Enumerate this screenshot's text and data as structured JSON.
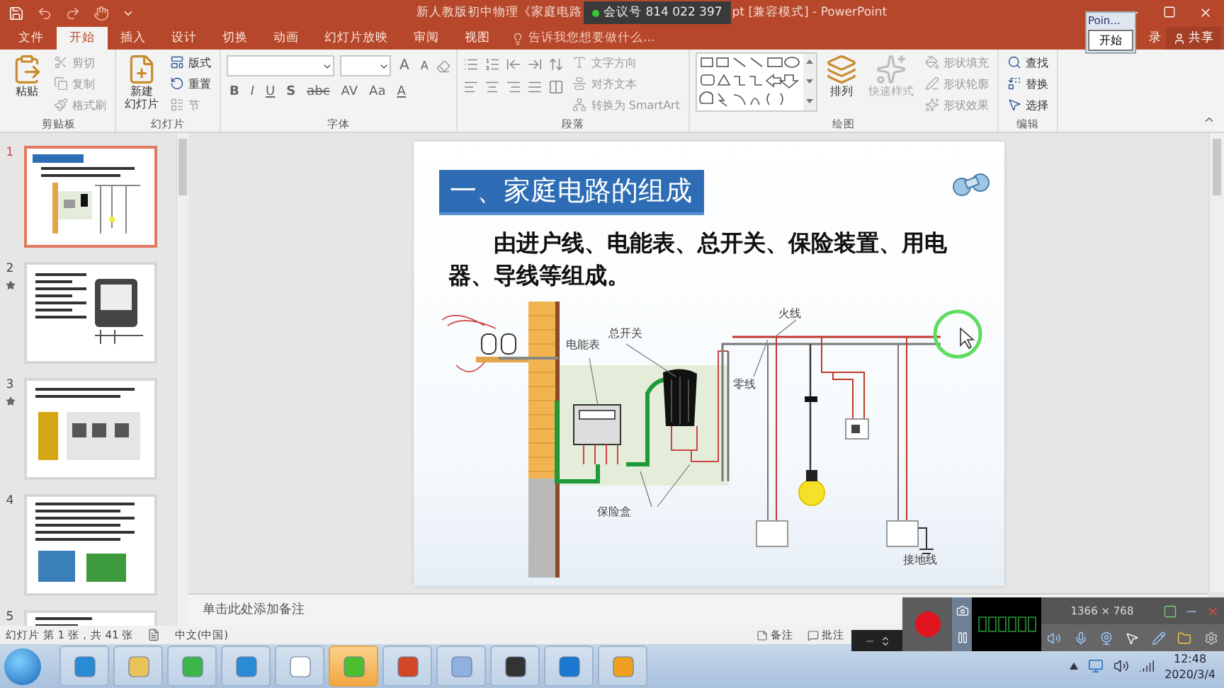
{
  "window": {
    "title_left": "新人教版初中物理《家庭电路",
    "title_right": "pt [兼容模式] - PowerPoint"
  },
  "meeting": {
    "label": "会议号 814 022 397"
  },
  "tabs": [
    {
      "label": "文件",
      "selected": false
    },
    {
      "label": "开始",
      "selected": true
    },
    {
      "label": "插入",
      "selected": false
    },
    {
      "label": "设计",
      "selected": false
    },
    {
      "label": "切换",
      "selected": false
    },
    {
      "label": "动画",
      "selected": false
    },
    {
      "label": "幻灯片放映",
      "selected": false
    },
    {
      "label": "审阅",
      "selected": false
    },
    {
      "label": "视图",
      "selected": false
    }
  ],
  "tell_me": {
    "placeholder": "告诉我您想要做什么..."
  },
  "account": {
    "login": "录",
    "share": "共享"
  },
  "pointer_popup": {
    "title": "Poin...",
    "button": "开始"
  },
  "ribbon": [
    {
      "label": "剪贴板",
      "columns": [
        {
          "kind": "large",
          "lines": [
            "粘贴"
          ],
          "disabled": false
        },
        {
          "kind": "stack",
          "items": [
            {
              "label": "剪切",
              "disabled": true
            },
            {
              "label": "复制",
              "disabled": true
            },
            {
              "label": "格式刷",
              "disabled": true
            }
          ]
        }
      ]
    },
    {
      "label": "幻灯片",
      "columns": [
        {
          "kind": "large",
          "lines": [
            "新建",
            "幻灯片"
          ],
          "disabled": false
        },
        {
          "kind": "stack",
          "items": [
            {
              "label": "版式",
              "disabled": false
            },
            {
              "label": "重置",
              "disabled": false
            },
            {
              "label": "节",
              "disabled": true
            }
          ]
        }
      ]
    },
    {
      "label": "字体",
      "columns": [
        {
          "kind": "font",
          "row1": [
            "A",
            "A"
          ],
          "row2": [
            "B",
            "I",
            "U",
            "S",
            "abc",
            "AV",
            "Aa",
            "A"
          ]
        }
      ]
    },
    {
      "label": "段落",
      "columns": [
        {
          "kind": "paragraph"
        },
        {
          "kind": "stack",
          "items": [
            {
              "label": "文字方向",
              "disabled": true
            },
            {
              "label": "对齐文本",
              "disabled": true
            },
            {
              "label": "转换为 SmartArt",
              "disabled": true
            }
          ]
        }
      ]
    },
    {
      "label": "绘图",
      "columns": [
        {
          "kind": "shapes"
        },
        {
          "kind": "large",
          "lines": [
            "排列"
          ],
          "disabled": false
        },
        {
          "kind": "large",
          "lines": [
            "快速样式"
          ],
          "disabled": true
        },
        {
          "kind": "stack",
          "items": [
            {
              "label": "形状填充",
              "disabled": true
            },
            {
              "label": "形状轮廓",
              "disabled": true
            },
            {
              "label": "形状效果",
              "disabled": true
            }
          ]
        }
      ]
    },
    {
      "label": "编辑",
      "columns": [
        {
          "kind": "stack",
          "items": [
            {
              "label": "查找",
              "disabled": false
            },
            {
              "label": "替换",
              "disabled": false
            },
            {
              "label": "选择",
              "disabled": false
            }
          ]
        }
      ]
    }
  ],
  "thumbnails": [
    {
      "number": "1",
      "selected": true,
      "animated": false
    },
    {
      "number": "2",
      "selected": false,
      "animated": true
    },
    {
      "number": "3",
      "selected": false,
      "animated": true
    },
    {
      "number": "4",
      "selected": false,
      "animated": false
    },
    {
      "number": "5",
      "selected": false,
      "animated": false
    }
  ],
  "slide": {
    "title": "一、家庭电路的组成",
    "body": "由进户线、电能表、总开关、保险装置、用电器、导线等组成。",
    "diagram": {
      "live_wire": "火线",
      "main_switch": "总开关",
      "meter": "电能表",
      "neutral_wire": "零线",
      "fuse_box": "保险盒",
      "ground_wire": "接地线"
    }
  },
  "notes": {
    "placeholder": "单击此处添加备注"
  },
  "status_bar": {
    "slide_counter": "幻灯片 第 1 张，共 41 张",
    "language": "中文(中国)",
    "notes_button": "备注",
    "comments_button": "批注"
  },
  "recorder": {
    "resolution": "1366 × 768"
  },
  "clock": {
    "time": "12:48",
    "date": "2020/3/4"
  }
}
